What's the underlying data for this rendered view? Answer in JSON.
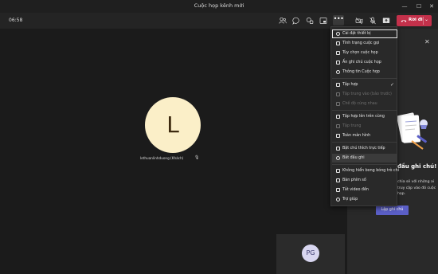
{
  "window": {
    "title": "Cuộc họp kênh mới"
  },
  "toolbar": {
    "timer": "06:58",
    "leave_label": "Rời đi",
    "icons": [
      "participants-icon",
      "chat-icon",
      "reactions-icon",
      "share-tray-icon",
      "more-actions-icon",
      "camera-off-icon",
      "mic-off-icon",
      "share-screen-icon",
      "leave-phone-icon"
    ]
  },
  "stage": {
    "participant_initial": "L",
    "participant_name": "lethuanlinhduong (Khách)",
    "self_initials": "PG"
  },
  "menu": {
    "items": [
      {
        "label": "Cài đặt thiết bị",
        "state": "focused"
      },
      {
        "label": "Tình trạng cuộc gọi",
        "state": "normal"
      },
      {
        "label": "Tùy chọn cuộc họp",
        "state": "normal"
      },
      {
        "label": "Ấn ghi chú cuộc họp",
        "state": "normal"
      },
      {
        "label": "Thông tin Cuộc họp",
        "state": "normal"
      },
      {
        "label": "Tập hợp",
        "state": "checked"
      },
      {
        "label": "Tập trung vào (bảo trước)",
        "state": "disabled"
      },
      {
        "label": "Chế độ cùng nhau",
        "state": "disabled"
      },
      {
        "label": "Tập hợp lên trên cùng",
        "state": "normal"
      },
      {
        "label": "Tập trung",
        "state": "disabled"
      },
      {
        "label": "Toàn màn hình",
        "state": "normal"
      },
      {
        "label": "Bật chú thích trực tiếp",
        "state": "normal"
      },
      {
        "label": "Bắt đầu ghi",
        "state": "highlighted"
      },
      {
        "label": "Không hiển bong bóng trò chi",
        "state": "normal"
      },
      {
        "label": "Bàn phím số",
        "state": "normal"
      },
      {
        "label": "Tắt video đến",
        "state": "normal"
      },
      {
        "label": "Trợ giúp",
        "state": "normal"
      }
    ]
  },
  "panel": {
    "heading": "đầu ghi chú!",
    "text": "chia sẻ với những ai truy cập vào đó cuộc họp.",
    "button_label": "Lập ghi chú"
  },
  "colors": {
    "accent": "#5b5fc7",
    "leave": "#c4314b",
    "avatar_bg": "#fbefc8"
  }
}
